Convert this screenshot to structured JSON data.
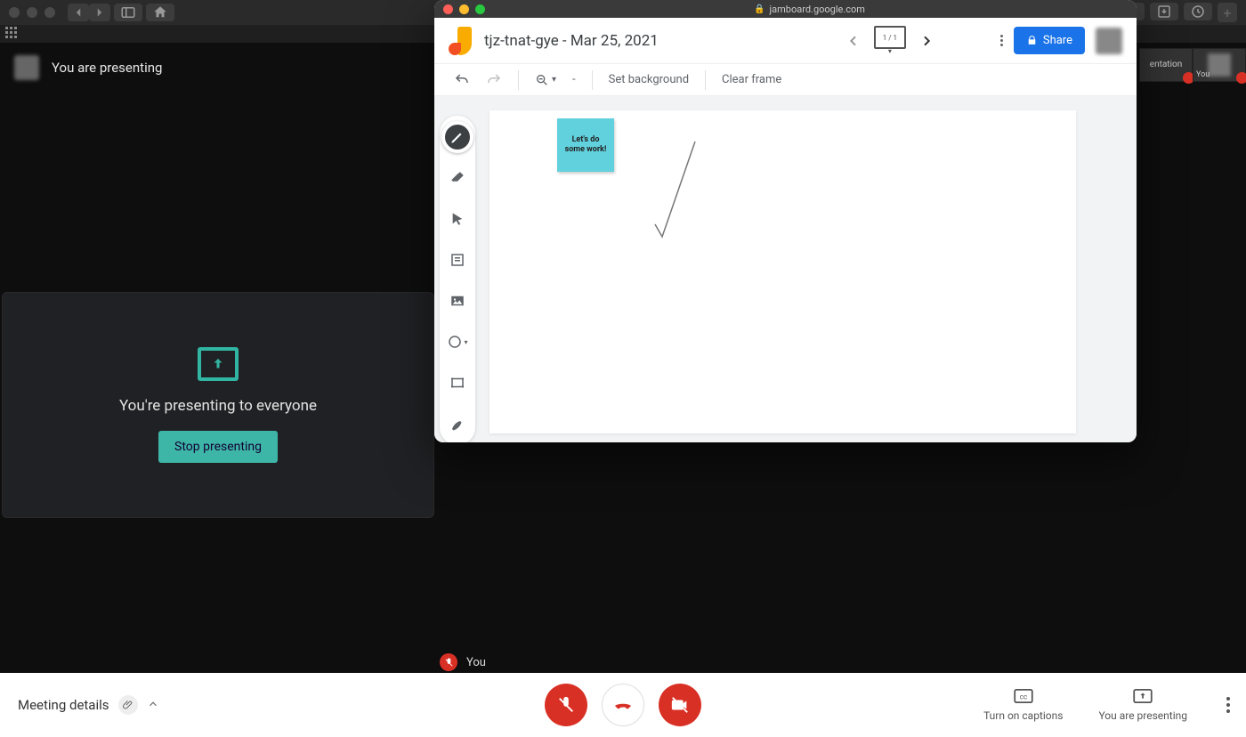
{
  "safari": {
    "right_icons": [
      "reader-icon",
      "download-icon",
      "history-icon"
    ]
  },
  "meet": {
    "presenting_label": "You are presenting",
    "panel_message": "You're presenting to everyone",
    "stop_button": "Stop presenting",
    "you_label": "You",
    "meeting_details": "Meeting details",
    "captions_label": "Turn on captions",
    "presenting_btn_label": "You are presenting",
    "tiles": {
      "presentation_label": "entation",
      "you_label": "You"
    }
  },
  "jamboard": {
    "url": "jamboard.google.com",
    "doc_title": "tjz-tnat-gye - Mar 25, 2021",
    "frame_count": "1 / 1",
    "share_label": "Share",
    "set_background": "Set background",
    "clear_frame": "Clear frame",
    "zoom_level": "-",
    "sticky_text": "Let's do some work!",
    "tools": [
      "pen",
      "eraser",
      "select",
      "sticky",
      "image",
      "circle",
      "textbox",
      "laser"
    ]
  }
}
